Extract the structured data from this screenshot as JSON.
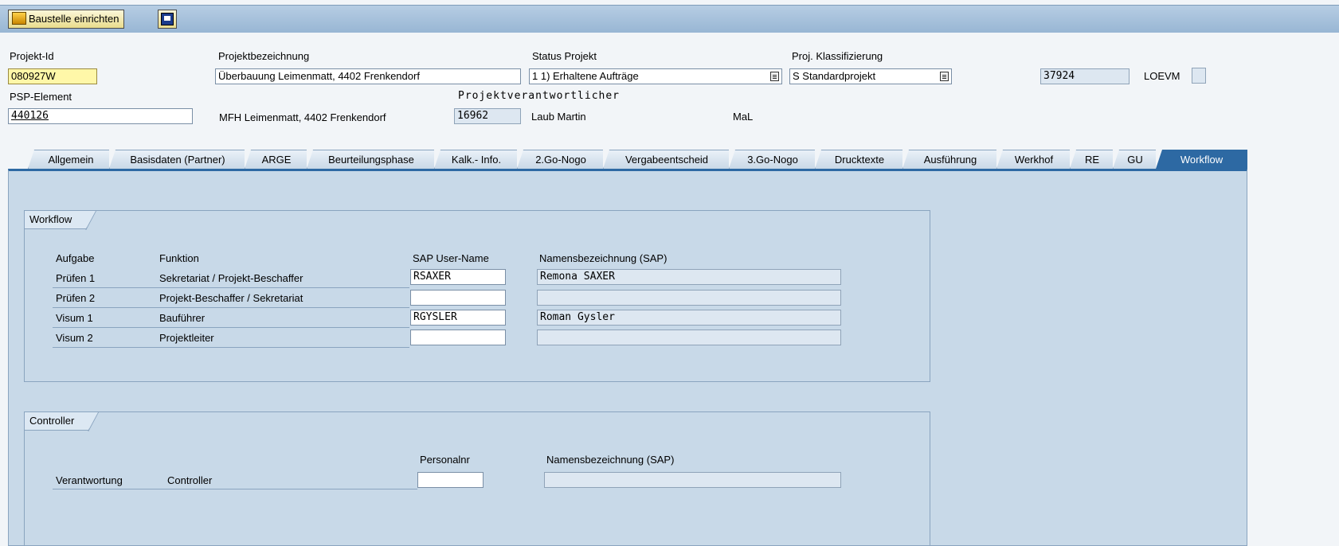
{
  "toolbar": {
    "button_label": "Baustelle einrichten",
    "button_icon": "construction-icon",
    "second_icon": "display-toggle-icon"
  },
  "header": {
    "projekt_id": {
      "label": "Projekt-Id",
      "value": "080927W"
    },
    "projektbezeichnung": {
      "label": "Projektbezeichnung",
      "value": "Überbauung Leimenmatt, 4402 Frenkendorf"
    },
    "status_projekt": {
      "label": "Status Projekt",
      "value": "1 1) Erhaltene Aufträge"
    },
    "proj_klassifizierung": {
      "label": "Proj. Klassifizierung",
      "value": "S Standardprojekt"
    },
    "number_field": "37924",
    "loevm": {
      "label": "LOEVM",
      "value": ""
    },
    "psp_element": {
      "label": "PSP-Element",
      "value": "440126"
    },
    "psp_description": "MFH Leimenmatt, 4402 Frenkendorf",
    "projektverantwortlicher": {
      "label": "Projektverantwortlicher",
      "number": "16962",
      "name": "Laub Martin",
      "short": "MaL"
    }
  },
  "tabs": [
    "Allgemein",
    "Basisdaten (Partner)",
    "ARGE",
    "Beurteilungsphase",
    "Kalk.- Info.",
    "2.Go-Nogo",
    "Vergabeentscheid",
    "3.Go-Nogo",
    "Drucktexte",
    "Ausführung",
    "Werkhof",
    "RE",
    "GU",
    "Workflow"
  ],
  "active_tab": "Workflow",
  "workflow": {
    "title": "Workflow",
    "headers": {
      "aufgabe": "Aufgabe",
      "funktion": "Funktion",
      "user": "SAP User-Name",
      "name": "Namensbezeichnung (SAP)"
    },
    "rows": [
      {
        "aufgabe": "Prüfen 1",
        "funktion": "Sekretariat / Projekt-Beschaffer",
        "user": "RSAXER",
        "name": "Remona SAXER"
      },
      {
        "aufgabe": "Prüfen 2",
        "funktion": "Projekt-Beschaffer / Sekretariat",
        "user": "",
        "name": ""
      },
      {
        "aufgabe": "Visum 1",
        "funktion": "Bauführer",
        "user": "RGYSLER",
        "name": "Roman Gysler"
      },
      {
        "aufgabe": "Visum 2",
        "funktion": "Projektleiter",
        "user": "",
        "name": ""
      }
    ]
  },
  "controller": {
    "title": "Controller",
    "headers": {
      "personalnr": "Personalnr",
      "name": "Namensbezeichnung (SAP)"
    },
    "row": {
      "verantwortung": "Verantwortung",
      "funktion": "Controller",
      "personalnr": "",
      "name": ""
    }
  },
  "colors": {
    "tab_active": "#2d69a3",
    "panel_bg": "#c8d9e8",
    "required_field": "#fff7a8"
  }
}
